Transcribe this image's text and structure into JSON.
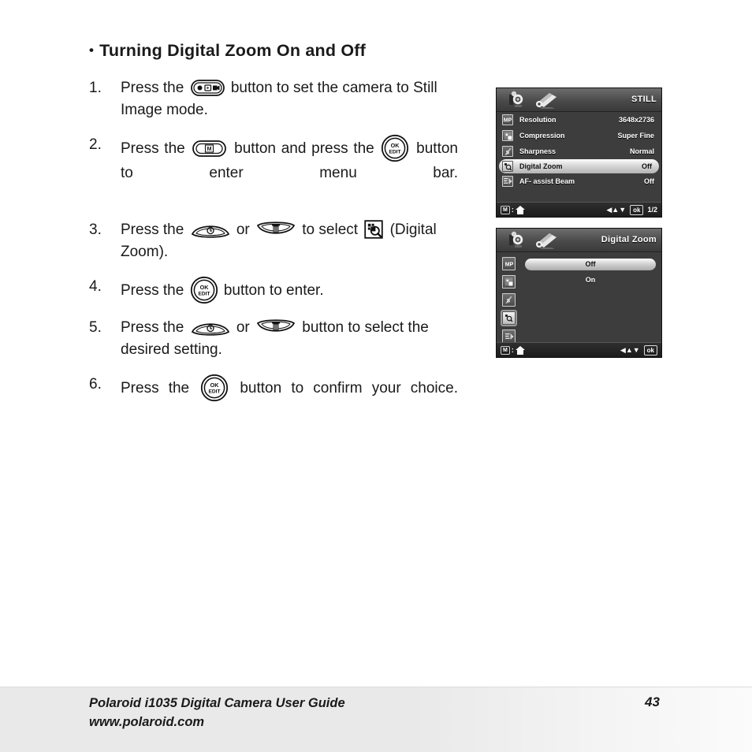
{
  "document": {
    "heading": "Turning Digital Zoom On and Off",
    "bullet": "•"
  },
  "steps": [
    {
      "num": "1.",
      "parts": [
        {
          "t": "text",
          "v": "Press the "
        },
        {
          "t": "icon",
          "v": "mode-button"
        },
        {
          "t": "text",
          "v": " button to set the camera to Still Image mode."
        }
      ]
    },
    {
      "num": "2.",
      "parts": [
        {
          "t": "text",
          "v": "Press the "
        },
        {
          "t": "icon",
          "v": "menu-button"
        },
        {
          "t": "text",
          "v": " button and press the "
        },
        {
          "t": "icon",
          "v": "ok-edit-button"
        },
        {
          "t": "text",
          "v": " button to enter menu bar."
        }
      ]
    },
    {
      "num": "3.",
      "parts": [
        {
          "t": "text",
          "v": "Press the "
        },
        {
          "t": "icon",
          "v": "up-fan-button"
        },
        {
          "t": "text",
          "v": " or "
        },
        {
          "t": "icon",
          "v": "down-fan-button"
        },
        {
          "t": "text",
          "v": " to select "
        },
        {
          "t": "icon",
          "v": "digital-zoom-icon"
        },
        {
          "t": "text",
          "v": " (Digital Zoom)."
        }
      ]
    },
    {
      "num": "4.",
      "parts": [
        {
          "t": "text",
          "v": "Press the "
        },
        {
          "t": "icon",
          "v": "ok-edit-button"
        },
        {
          "t": "text",
          "v": " button to enter."
        }
      ]
    },
    {
      "num": "5.",
      "parts": [
        {
          "t": "text",
          "v": "Press the "
        },
        {
          "t": "icon",
          "v": "up-fan-button"
        },
        {
          "t": "text",
          "v": " or "
        },
        {
          "t": "icon",
          "v": "down-fan-button"
        },
        {
          "t": "text",
          "v": " button to select the desired setting."
        }
      ]
    },
    {
      "num": "6.",
      "parts": [
        {
          "t": "text",
          "v": "Press the "
        },
        {
          "t": "icon",
          "v": "ok-edit-button"
        },
        {
          "t": "text",
          "v": " button to confirm your choice."
        }
      ]
    }
  ],
  "button_labels": {
    "ok": "OK",
    "edit": "EDIT",
    "menu_m": "M"
  },
  "lcd_still": {
    "title": "STILL",
    "rows": [
      {
        "icon": "mp-resolution-icon",
        "label": "Resolution",
        "value": "3648x2736",
        "selected": false
      },
      {
        "icon": "compression-icon",
        "label": "Compression",
        "value": "Super Fine",
        "selected": false
      },
      {
        "icon": "sharpness-icon",
        "label": "Sharpness",
        "value": "Normal",
        "selected": false
      },
      {
        "icon": "digital-zoom-icon",
        "label": "Digital Zoom",
        "value": "Off",
        "selected": true
      },
      {
        "icon": "af-assist-icon",
        "label": "AF- assist Beam",
        "value": "Off",
        "selected": false
      }
    ],
    "footer": {
      "m_key": "M",
      "colon": ":",
      "home_icon": "home-icon",
      "arrows": "◀▲▼",
      "ok": "ok",
      "page": "1/2"
    }
  },
  "lcd_digital_zoom": {
    "title": "Digital Zoom",
    "side_icons": [
      "mp-resolution-icon",
      "compression-icon",
      "sharpness-icon",
      "digital-zoom-icon",
      "af-assist-icon"
    ],
    "current_side_icon_index": 3,
    "options": [
      {
        "label": "Off",
        "selected": true
      },
      {
        "label": "On",
        "selected": false
      }
    ],
    "footer": {
      "m_key": "M",
      "colon": ":",
      "home_icon": "home-icon",
      "arrows": "◀▲▼",
      "ok": "ok",
      "page": ""
    }
  },
  "footer": {
    "guide_title": "Polaroid i1035 Digital Camera User Guide",
    "website": "www.polaroid.com",
    "page_number": "43"
  },
  "colors": {
    "lcd_background": "#3d3d3d",
    "lcd_header": "#4a4a4a",
    "lcd_footer": "#1b1b1b",
    "selection_highlight": "#e2e2e2",
    "page_footer_band": "#e9e9e9",
    "text": "#1a1a1a"
  }
}
